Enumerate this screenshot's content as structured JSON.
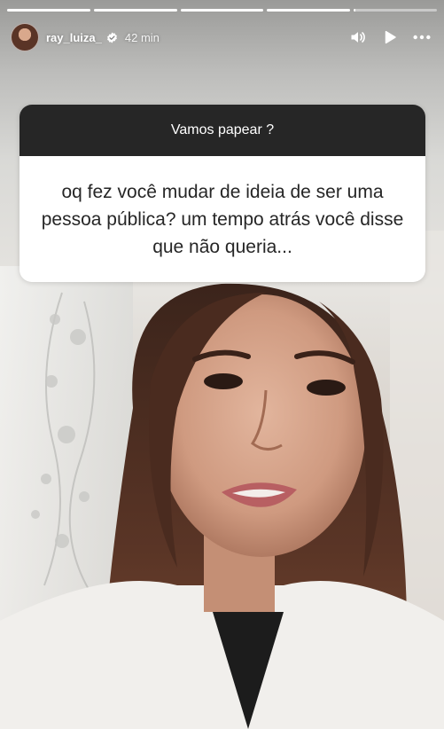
{
  "story": {
    "progress": [
      1,
      1,
      1,
      1,
      0.02
    ]
  },
  "header": {
    "username": "ray_luiza_",
    "time": "42 min",
    "icons": [
      "verified-badge-icon",
      "volume-icon",
      "play-icon",
      "more-icon"
    ]
  },
  "question_sticker": {
    "title": "Vamos papear ?",
    "question": "oq fez você mudar de ideia de ser uma pessoa pública? um tempo atrás você disse que não queria..."
  },
  "colors": {
    "sticker_header": "#262626",
    "sticker_body": "#ffffff",
    "text_dark": "#262626"
  }
}
